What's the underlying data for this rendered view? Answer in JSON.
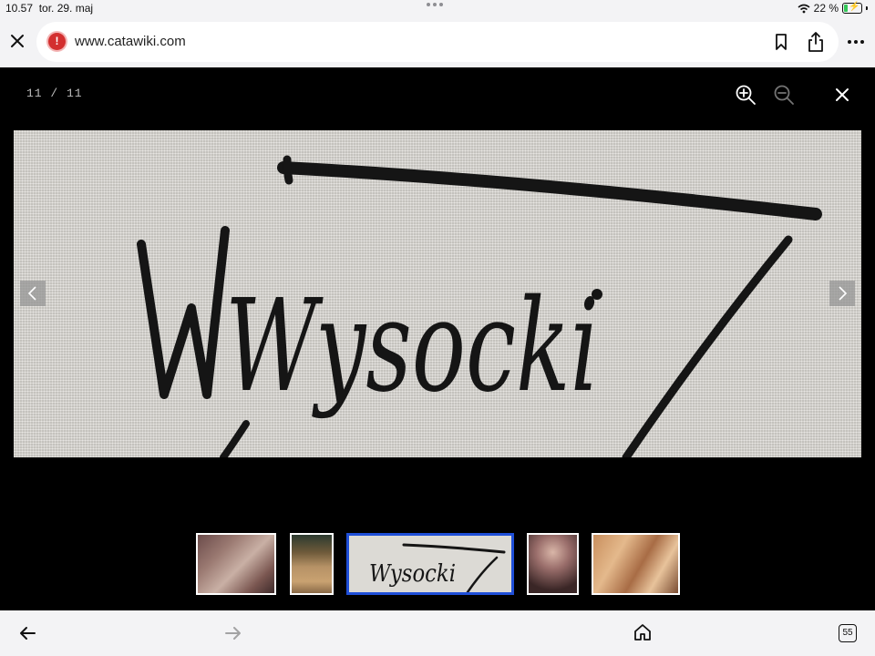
{
  "status_bar": {
    "time": "10.57",
    "date": "tor. 29. maj",
    "battery_percent": "22 %",
    "battery_level": 0.22
  },
  "browser": {
    "url": "www.catawiki.com",
    "warning_glyph": "!",
    "tab_count": "55",
    "icons": [
      "close-icon",
      "warning-icon",
      "bookmark-icon",
      "share-icon",
      "more-icon",
      "back-icon",
      "forward-icon",
      "home-icon",
      "tabs-icon"
    ]
  },
  "viewer": {
    "counter": "11 / 11",
    "main_image_text": "Wysocki",
    "icons": [
      "zoom-in-icon",
      "zoom-out-icon",
      "close-icon",
      "chevron-left-icon",
      "chevron-right-icon"
    ]
  },
  "thumbnails": [
    {
      "selected": false
    },
    {
      "selected": false
    },
    {
      "selected": true,
      "text": "Wysocki"
    },
    {
      "selected": false
    },
    {
      "selected": false
    }
  ],
  "colors": {
    "viewer_bg": "#000000",
    "selected_border": "#1f4fd8",
    "warning": "#d32f2f",
    "battery": "#34c759"
  }
}
